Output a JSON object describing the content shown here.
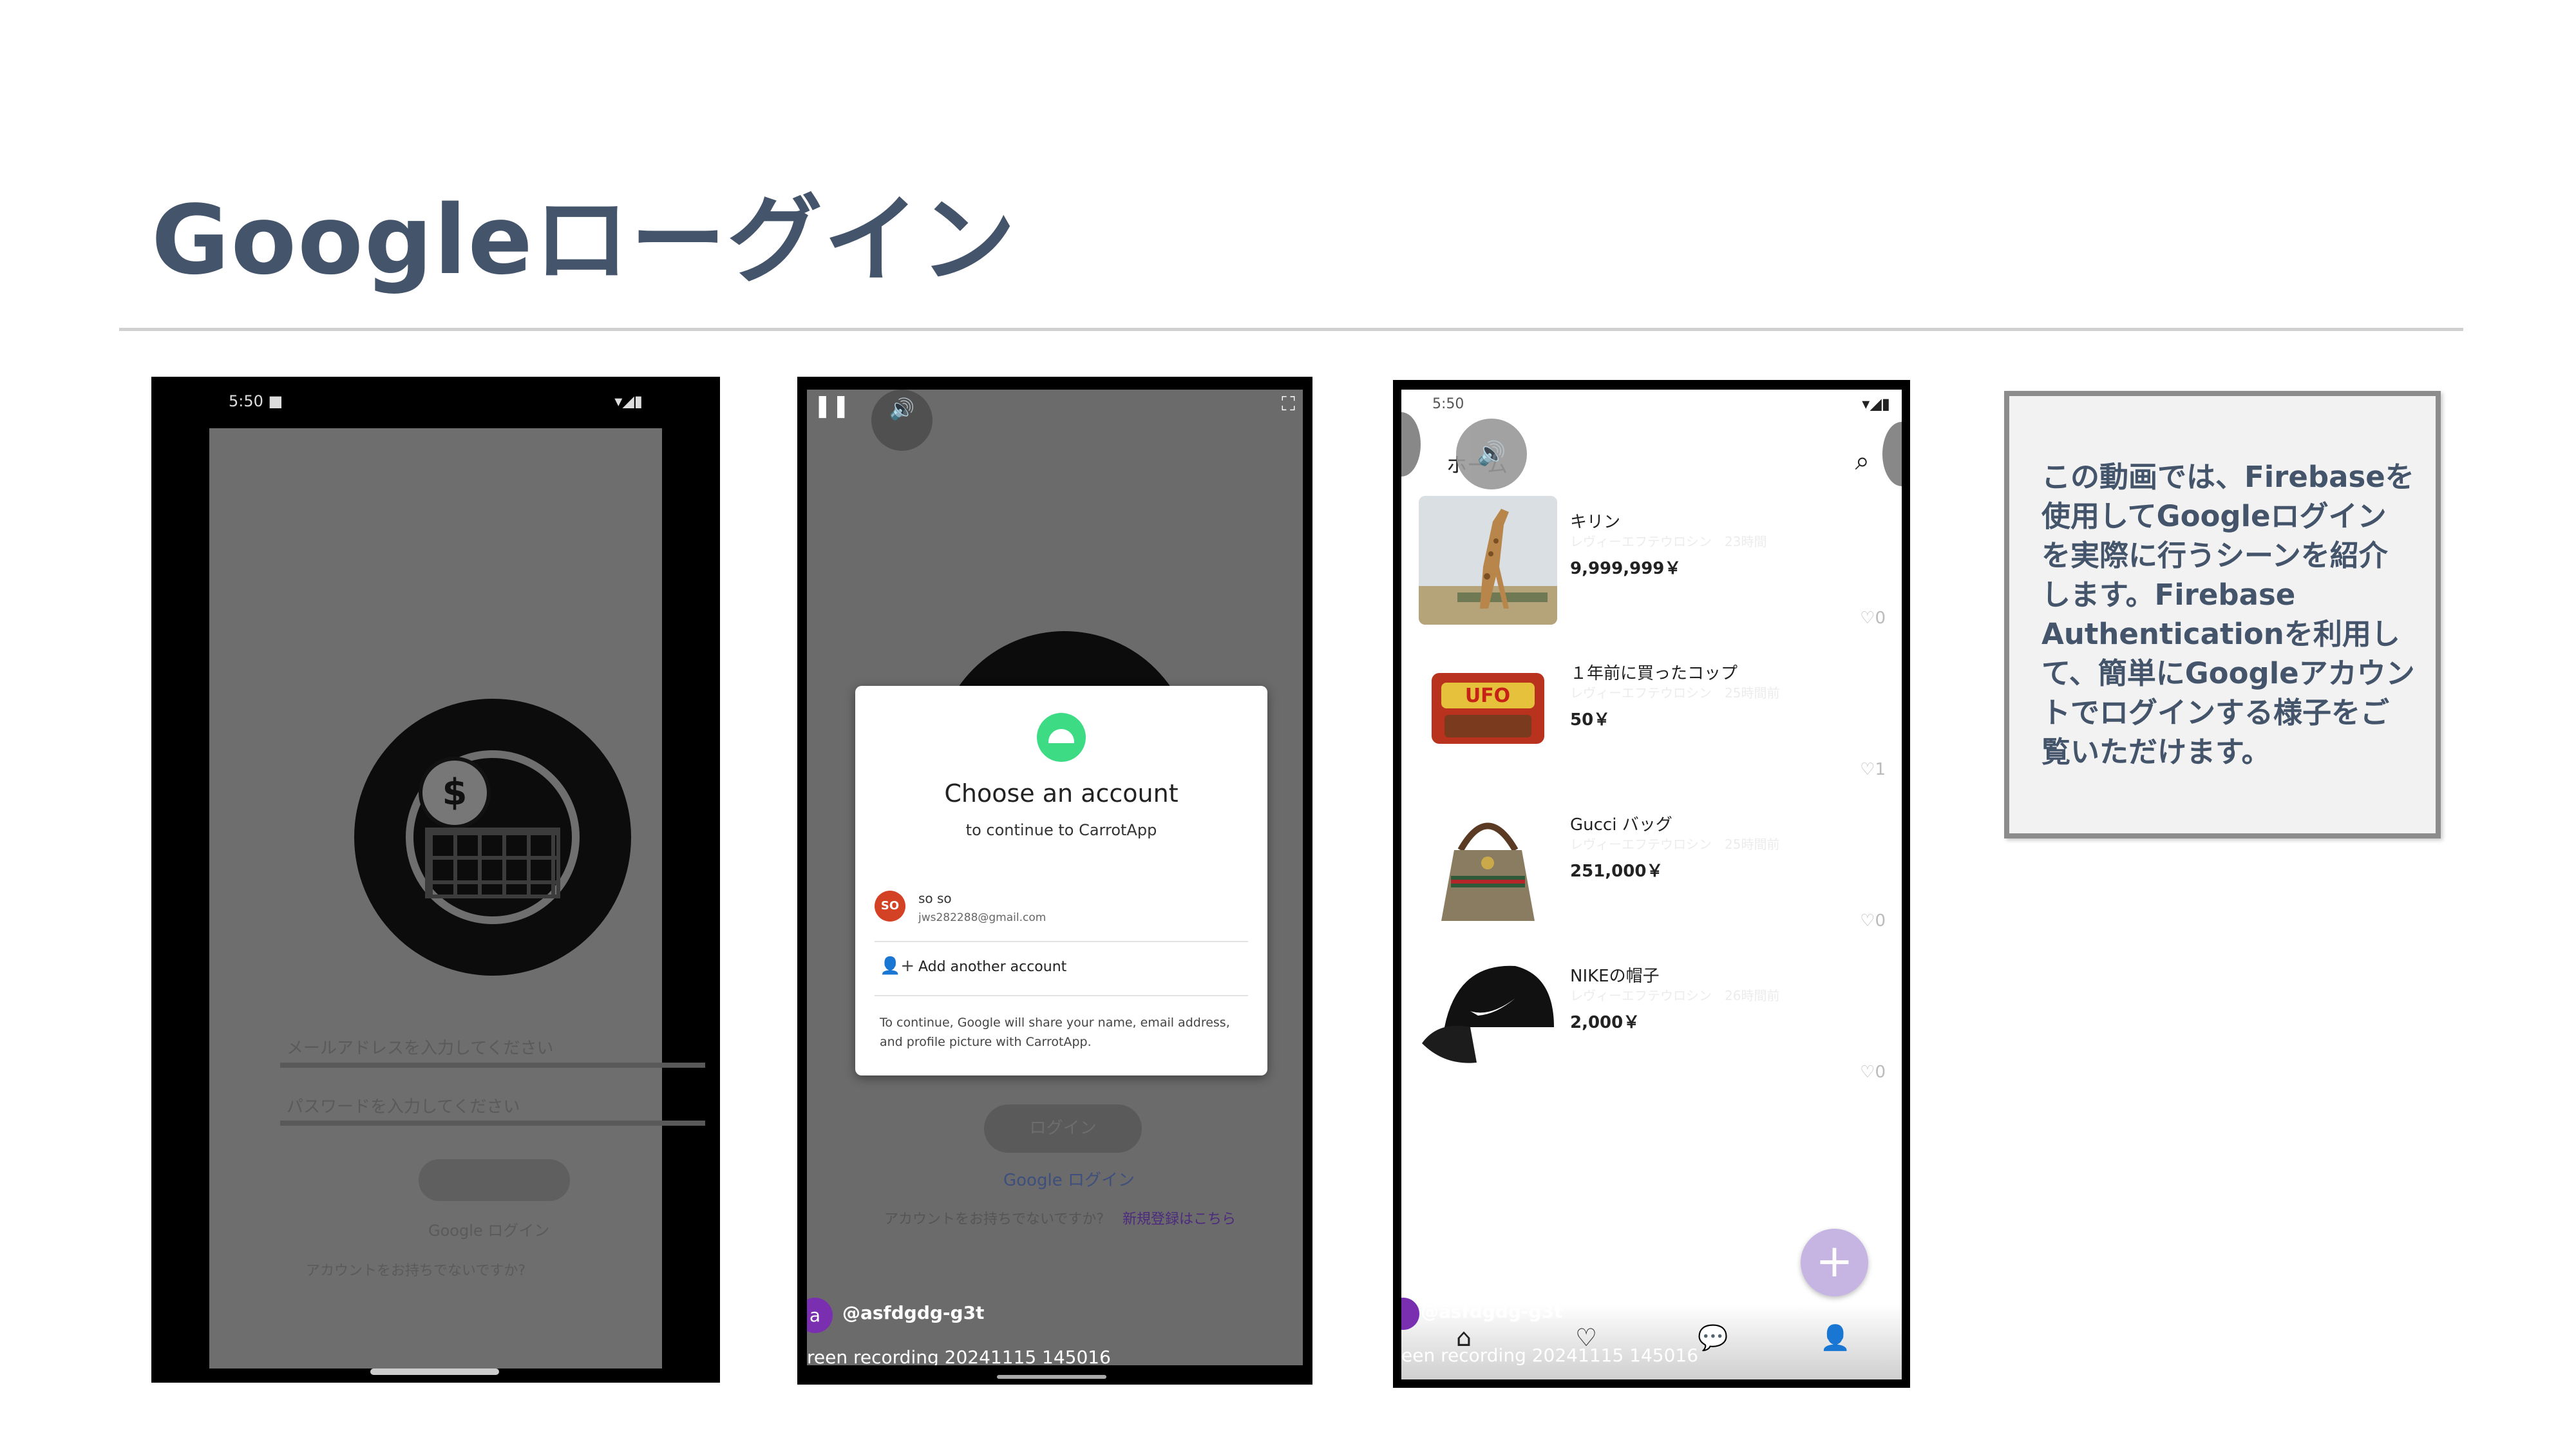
{
  "slide": {
    "title": "Googleローグイン"
  },
  "phone1": {
    "status_left": "5:50 ■",
    "status_right": "▾◢▮",
    "coin_symbol": "$",
    "field1_label": "メールアドレスを入力してください",
    "field2_label": "パスワードを入力してください",
    "link": "Google ログイン",
    "bottom_text": "アカウントをお持ちでないですか?"
  },
  "phone2": {
    "pause_icon": "❚❚",
    "volume_icon": "🔊",
    "fullscreen_icon": "⛶",
    "dialog": {
      "title": "Choose an account",
      "subtitle": "to continue to CarrotApp",
      "avatar_text": "SO",
      "account_name": "so so",
      "account_email": "jws282288@gmail.com",
      "add_icon": "👤+",
      "add_account": "Add another account",
      "notice": "To continue, Google will share your name, email address, and profile picture with CarrotApp."
    },
    "login_button": "ログイン",
    "google_login": "Google ログイン",
    "no_account": "アカウントをお持ちでないですか?",
    "register": "新規登録はこちら",
    "overlay_avatar": "a",
    "overlay_user": "@asfdgdg-g3t",
    "overlay_recording": "reen recording 20241115 145016"
  },
  "phone3": {
    "status_time": "5:50",
    "status_icons": "▾◢▮",
    "volume_icon": "🔊",
    "home_title": "ホーム",
    "search_icon": "⌕",
    "items": [
      {
        "name": "キリン",
        "sub": "レヴィーエフテウロシン　23時間",
        "price": "9,999,999￥",
        "likes": "♡0"
      },
      {
        "name": "１年前に買ったコップ",
        "sub": "レヴィーエフテウロシン　25時間前",
        "price": "50￥",
        "likes": "♡1"
      },
      {
        "name": "Gucci バッグ",
        "sub": "レヴィーエフテウロシン　25時間前",
        "price": "251,000￥",
        "likes": "♡0"
      },
      {
        "name": "NIKEの帽子",
        "sub": "レヴィーエフテウロシン　26時間前",
        "price": "2,000￥",
        "likes": "♡0"
      }
    ],
    "fab_icon": "+",
    "nav": {
      "home": "⌂",
      "likes": "♡",
      "chat": "💬",
      "profile": "👤"
    },
    "overlay_user": "@asfdgdg-g3t",
    "overlay_recording": "een recording 20241115 145016"
  },
  "note": {
    "text": "この動画では、Firebaseを使用してGoogleログインを実際に行うシーンを紹介します。Firebase Authenticationを利用して、簡単にGoogleアカウントでログインする様子をご覧いただけます。"
  }
}
